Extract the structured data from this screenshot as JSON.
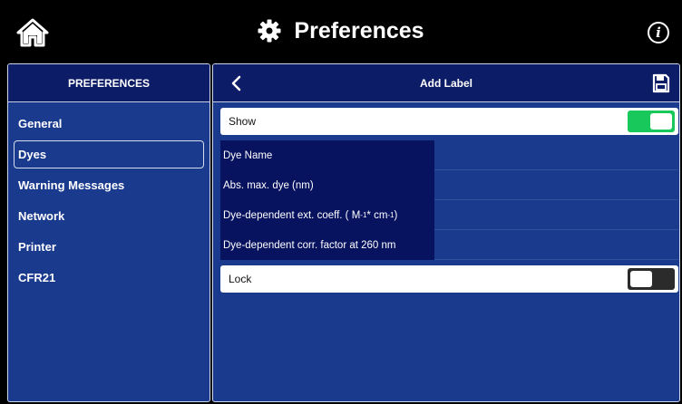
{
  "app": {
    "title": "Preferences"
  },
  "icons": {
    "home": "home-icon",
    "gear": "gear-icon",
    "info": "info-icon",
    "back": "chevron-left-icon",
    "save": "save-icon"
  },
  "colors": {
    "accent_dark": "#0d1c66",
    "panel": "#1a3a8e",
    "toggle_on": "#19c85a",
    "toggle_off": "#2b2b2b"
  },
  "sidebar": {
    "header": "PREFERENCES",
    "items": [
      {
        "label": "General",
        "active": false
      },
      {
        "label": "Dyes",
        "active": true
      },
      {
        "label": "Warning Messages",
        "active": false
      },
      {
        "label": "Network",
        "active": false
      },
      {
        "label": "Printer",
        "active": false
      },
      {
        "label": "CFR21",
        "active": false
      }
    ]
  },
  "main": {
    "header": "Add Label",
    "show": {
      "label": "Show",
      "on": true
    },
    "fields": [
      {
        "label": "Dye Name",
        "value": ""
      },
      {
        "label": "Abs. max. dye (nm)",
        "value": ""
      },
      {
        "label_pre": "Dye-dependent ext. coeff. ( M ",
        "sup1": "-1",
        "label_mid": " * cm ",
        "sup2": "-1",
        "label_post": ")",
        "value": ""
      },
      {
        "label": "Dye-dependent corr. factor at 260 nm",
        "value": ""
      }
    ],
    "lock": {
      "label": "Lock",
      "on": false
    }
  }
}
